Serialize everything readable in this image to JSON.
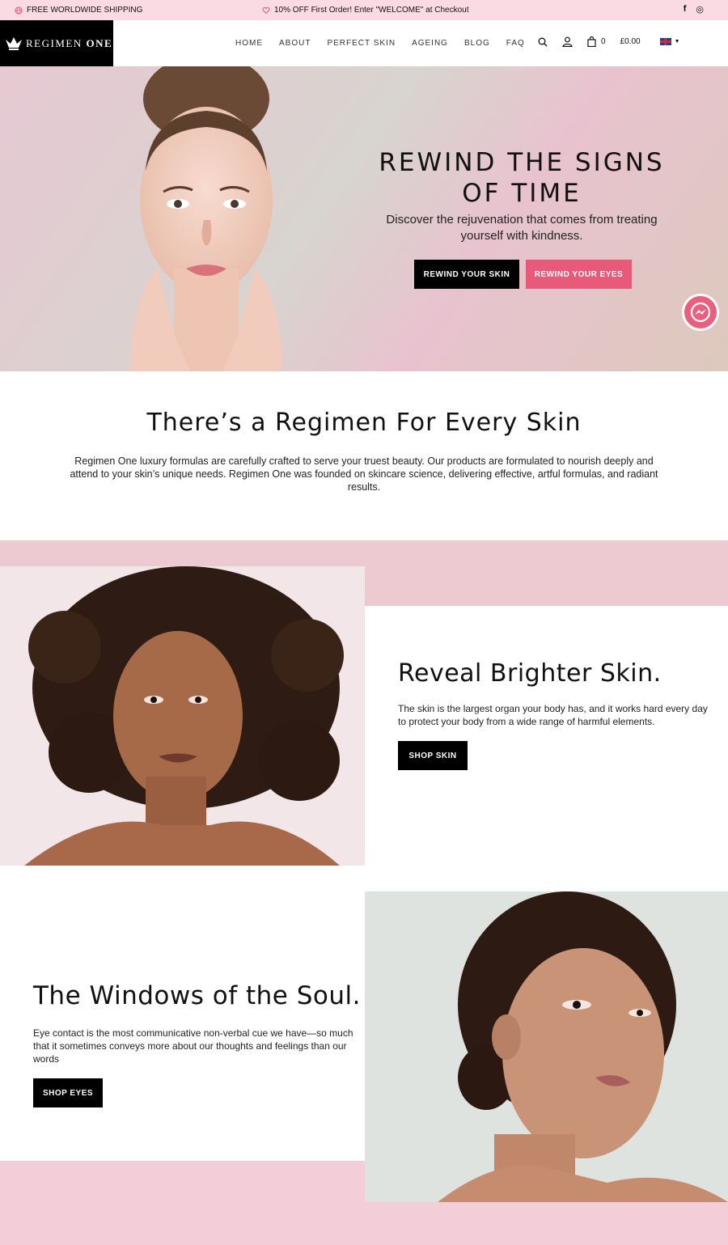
{
  "announcement": {
    "shipping": "FREE WORLDWIDE SHIPPING",
    "promo": "10% OFF First Order! Enter \"WELCOME\" at Checkout",
    "social": [
      "f",
      "◎"
    ]
  },
  "header": {
    "brand_light": "REGIMEN ",
    "brand_bold": "ONE",
    "nav": [
      "HOME",
      "ABOUT",
      "PERFECT SKIN",
      "AGEING",
      "BLOG",
      "FAQ"
    ],
    "cart_count": "0",
    "cart_total": "£0.00"
  },
  "hero": {
    "title": "REWIND THE SIGNS OF TIME",
    "subtitle": "Discover the rejuvenation that comes from treating yourself with kindness.",
    "btn_skin": "REWIND YOUR SKIN",
    "btn_eyes": "REWIND YOUR EYES"
  },
  "intro": {
    "title": "There’s a Regimen For Every Skin",
    "text": "Regimen One luxury formulas are carefully crafted to serve your truest beauty. Our products are formulated to nourish deeply and attend to your skin’s unique needs. Regimen One was founded on skincare science, delivering effective, artful formulas, and radiant results."
  },
  "skin_section": {
    "title": "Reveal Brighter Skin.",
    "text": "The skin is the largest organ your body has, and it works hard every day to protect your body from a wide range of harmful elements.",
    "button": "SHOP SKIN"
  },
  "eyes_section": {
    "title": "The Windows of the Soul.",
    "text": "Eye contact is the most communicative non-verbal cue we have—so much that it sometimes conveys more about our thoughts and feelings than our words",
    "button": "SHOP EYES"
  },
  "colors": {
    "announcement_bg": "#fadbe3",
    "accent_pink": "#e8597a",
    "band_pink": "#edc9d1",
    "black": "#000000"
  }
}
